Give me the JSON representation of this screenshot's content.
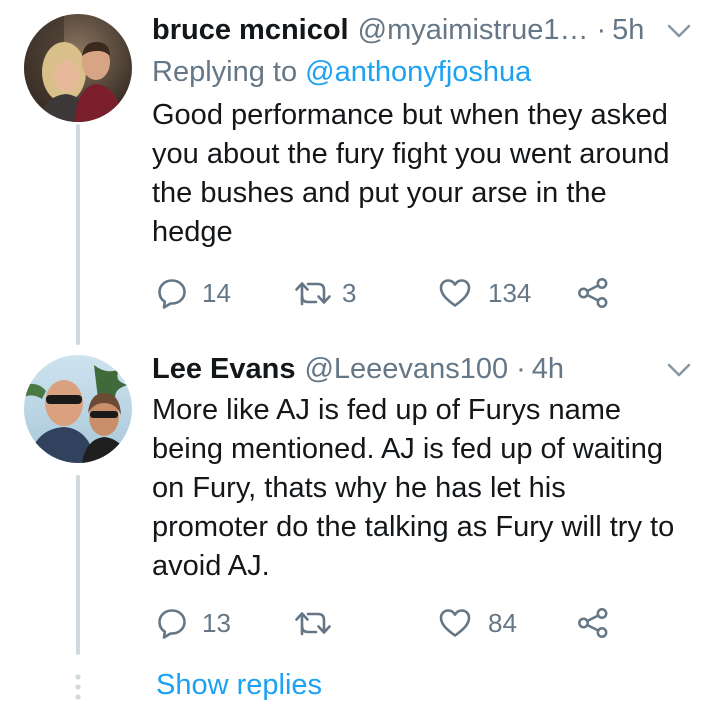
{
  "tweets": [
    {
      "name": "bruce mcnicol",
      "handle": "@myaimistrue1…",
      "separator": "·",
      "time": "5h",
      "replying_prefix": "Replying to",
      "replying_to": "@anthonyfjoshua",
      "text": "Good performance but when they asked\nyou about the fury fight you went around\nthe bushes and put your arse in the\nhedge",
      "replies": "14",
      "retweets": "3",
      "likes": "134"
    },
    {
      "name": "Lee Evans",
      "handle": "@Leeevans100",
      "separator": "·",
      "time": "4h",
      "text": "More like AJ is fed up of Furys name\nbeing mentioned. AJ is fed up of waiting\non Fury, thats why he has let his\npromoter do the talking as Fury will try to\navoid AJ.",
      "replies": "13",
      "retweets": "",
      "likes": "84"
    }
  ],
  "show_replies": "Show replies",
  "icons": {
    "reply": "reply-icon",
    "retweet": "retweet-icon",
    "like": "heart-icon",
    "share": "share-icon",
    "menu": "chevron-down-icon"
  },
  "colors": {
    "text": "#14171a",
    "secondary": "#657786",
    "link": "#1da1f2",
    "thread_line": "#cfd9de"
  }
}
